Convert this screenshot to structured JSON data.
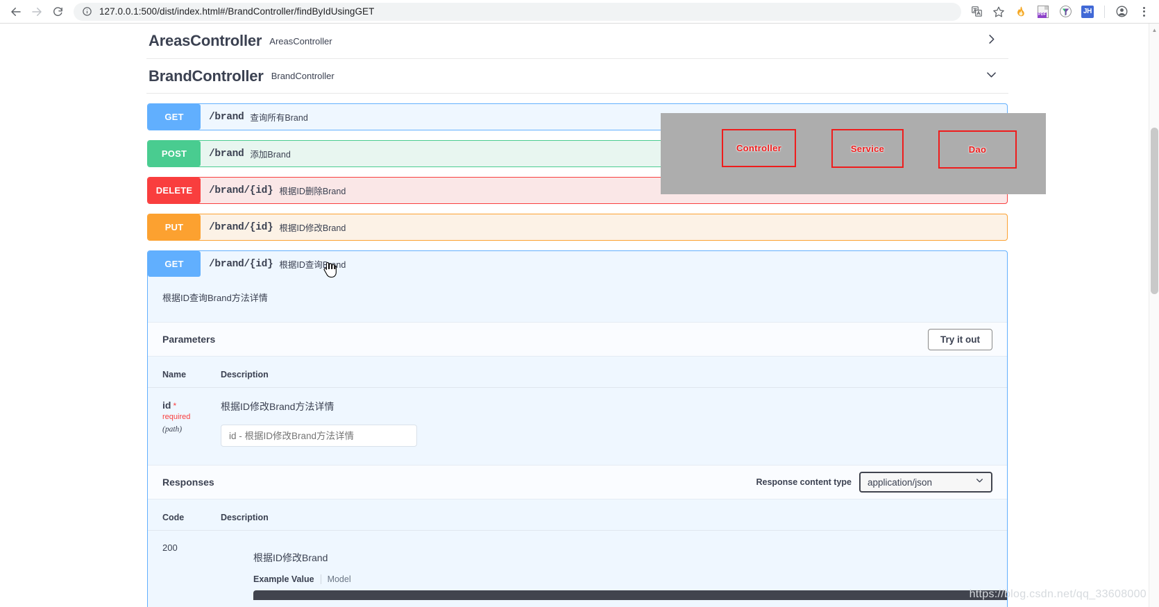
{
  "browser": {
    "back_label": "Back",
    "forward_label": "Forward",
    "reload_label": "Reload",
    "url": "127.0.0.1:500/dist/index.html#/BrandController/findByIdUsingGET",
    "site_info_icon": "info-icon",
    "icons": [
      {
        "name": "translate-icon",
        "label": "Translate"
      },
      {
        "name": "bookmark-star-icon",
        "label": "Bookmark this tab"
      },
      {
        "name": "extension-flame-icon",
        "label": "Extension"
      },
      {
        "name": "pdf-extension-icon",
        "label": "PDF",
        "badge": "PDF"
      },
      {
        "name": "extension-funnel-icon",
        "label": "Extension"
      },
      {
        "name": "profile-badge-icon",
        "label": "JH"
      },
      {
        "name": "avatar-icon",
        "label": "Profile"
      },
      {
        "name": "chrome-menu-icon",
        "label": "Customize and control"
      }
    ]
  },
  "swagger": {
    "tags": [
      {
        "name": "AreasController",
        "description": "AreasController",
        "expanded": false,
        "arrow_icon": "chevron-right-icon"
      },
      {
        "name": "BrandController",
        "description": "BrandController",
        "expanded": true,
        "arrow_icon": "chevron-down-icon"
      }
    ],
    "operations": [
      {
        "method": "GET",
        "path": "/brand",
        "summary": "查询所有Brand",
        "expanded": false
      },
      {
        "method": "POST",
        "path": "/brand",
        "summary": "添加Brand",
        "expanded": false
      },
      {
        "method": "DELETE",
        "path": "/brand/{id}",
        "summary": "根据ID删除Brand",
        "expanded": false
      },
      {
        "method": "PUT",
        "path": "/brand/{id}",
        "summary": "根据ID修改Brand",
        "expanded": false
      },
      {
        "method": "GET",
        "path": "/brand/{id}",
        "summary": "根据ID查询Brand",
        "expanded": true
      }
    ],
    "expanded_op": {
      "note": "根据ID查询Brand方法详情",
      "parameters_title": "Parameters",
      "try_it_out_label": "Try it out",
      "param_columns": {
        "name": "Name",
        "description": "Description"
      },
      "parameters": [
        {
          "name": "id",
          "required_label": "required",
          "required_star": "*",
          "in": "(path)",
          "description": "根据ID修改Brand方法详情",
          "input_placeholder": "id - 根据ID修改Brand方法详情",
          "input_value": ""
        }
      ],
      "responses_title": "Responses",
      "content_type_label": "Response content type",
      "content_type_value": "application/json",
      "content_type_options": [
        "application/json"
      ],
      "resp_columns": {
        "code": "Code",
        "description": "Description"
      },
      "responses": [
        {
          "code": "200",
          "description": "根据ID修改Brand",
          "tab_example": "Example Value",
          "tab_model": "Model"
        }
      ]
    }
  },
  "overlay": {
    "boxes": [
      {
        "label": "Controller"
      },
      {
        "label": "Service"
      },
      {
        "label": "Dao"
      }
    ],
    "background_color": "#adadad",
    "box_border_color": "#ef1c1c"
  },
  "watermark": {
    "text": "https://blog.csdn.net/qq_33608000"
  },
  "colors": {
    "get": "#61affe",
    "post": "#49cc90",
    "delete": "#f93e3e",
    "put": "#fca130",
    "text": "#3b4151"
  }
}
